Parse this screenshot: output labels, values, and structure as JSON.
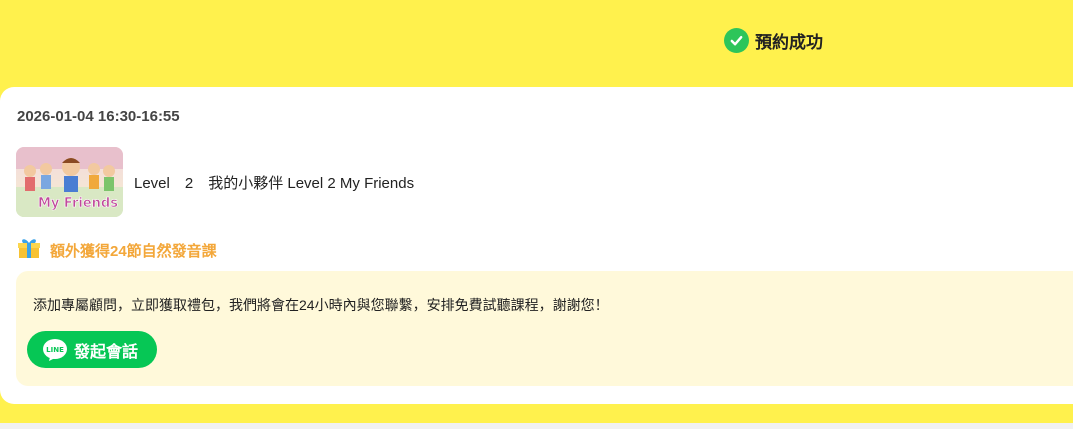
{
  "header": {
    "status_text": "預約成功",
    "status_icon": "check-circle-icon",
    "status_color": "#2dc55a"
  },
  "booking": {
    "datetime": "2026-01-04 16:30-16:55",
    "course_title": "Level　2　我的小夥伴 Level 2 My Friends",
    "thumbnail_caption": "My Friends"
  },
  "bonus": {
    "icon": "gift-icon",
    "text": "額外獲得24節自然發音課",
    "color": "#f3a73a"
  },
  "consult": {
    "message": "添加專屬顧問，立即獲取禮包，我們將會在24小時內與您聯繫，安排免費試聽課程，謝謝您！",
    "button_label": "發起會話",
    "button_icon": "line-app-icon",
    "line_icon_text": "LINE",
    "button_color": "#06c755"
  },
  "colors": {
    "background": "#fff14d",
    "card": "#ffffff",
    "info_box": "#fff9da"
  }
}
